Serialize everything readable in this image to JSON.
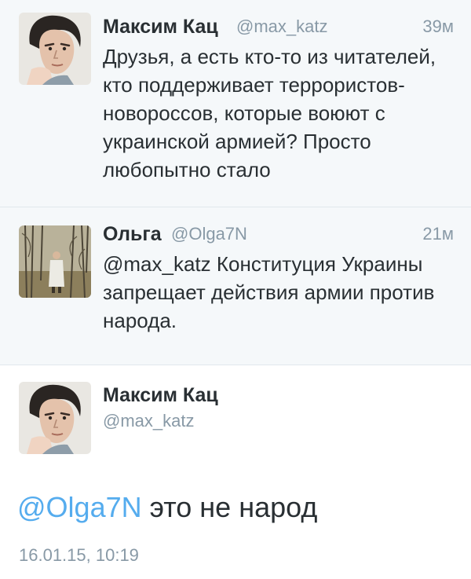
{
  "tweets": [
    {
      "name": "Максим Кац",
      "handle": "@max_katz",
      "time": "39м",
      "text_lines": [
        "Друзья, а есть кто-то из читателей,",
        "кто поддерживает террористов-",
        "новороссов, которые воюют с",
        "украинской армией? Просто",
        "любопытно стало"
      ]
    },
    {
      "name": "Ольга",
      "handle": "@Olga7N",
      "time": "21м",
      "mention": "@max_katz",
      "text_lines": [
        " Конституция Украины",
        "запрещает действия армии против",
        "народа."
      ]
    }
  ],
  "detail": {
    "name": "Максим Кац",
    "handle": "@max_katz",
    "mention": "@Olga7N",
    "text": " это не народ",
    "date": "16.01.15, 10:19"
  },
  "colors": {
    "link": "#55acee",
    "secondary_text": "#8899a6",
    "background_timeline": "#f5f8fa",
    "separator": "#e1e8ed"
  },
  "icons": {
    "avatar_max": "avatar-illustrated-portrait",
    "avatar_olga": "avatar-photo-forest"
  }
}
